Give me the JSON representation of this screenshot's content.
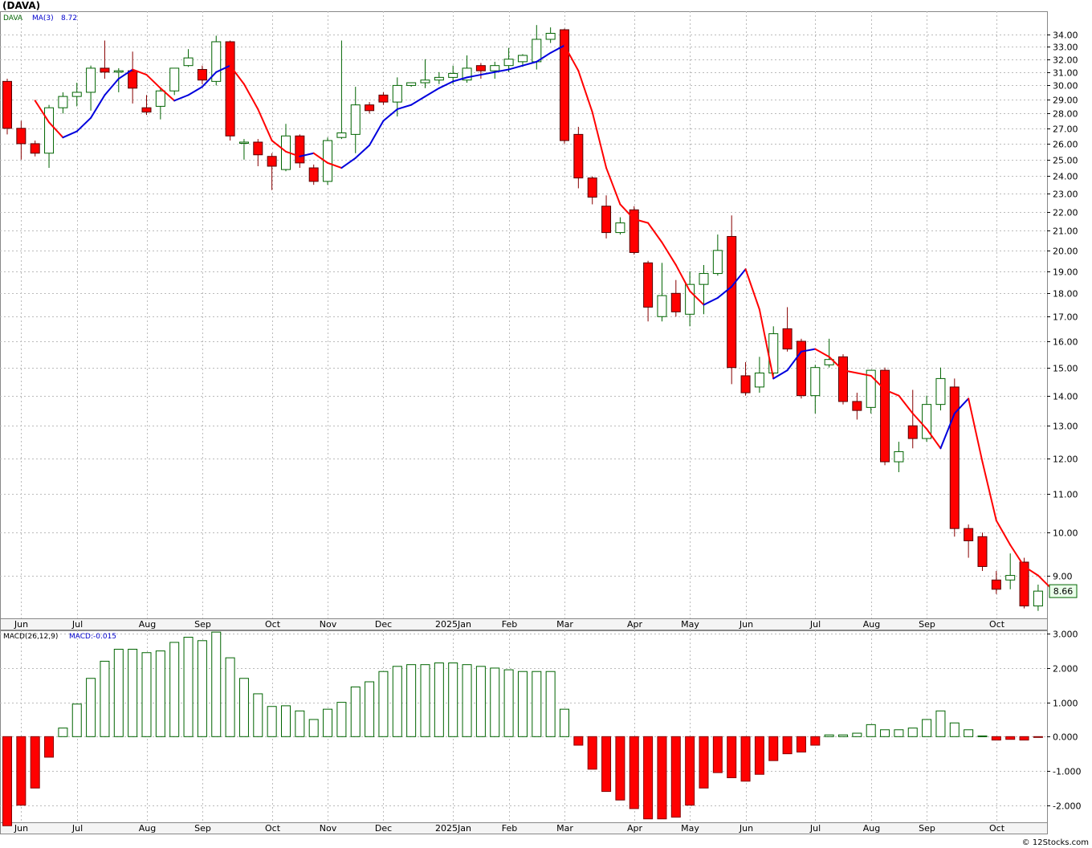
{
  "title": "(DAVA)",
  "watermark": "© 12Stocks.com",
  "legend": {
    "symbol": "DAVA",
    "ma_label": "MA(3)",
    "ma_value": "8.72",
    "macd_label": "MACD(26,12,9)",
    "macd_value": "MACD:-0.015"
  },
  "colors": {
    "up": "#006400",
    "down": "#ff0000",
    "ma_up": "#0000dd",
    "ma_down": "#ff0000",
    "bg": "#ffffff",
    "grid": "#bbbbbb"
  },
  "last_price_label": "8.66",
  "chart_data": [
    {
      "type": "candlestick",
      "scale": "log",
      "ylim": [
        8.1,
        36.0
      ],
      "yticks": [
        9,
        10,
        11,
        12,
        13,
        14,
        15,
        16,
        17,
        18,
        19,
        20,
        21,
        22,
        23,
        24,
        25,
        26,
        27,
        28,
        29,
        30,
        31,
        32,
        33,
        34
      ],
      "ytick_labels": [
        "9.00",
        "10.00",
        "11.00",
        "12.00",
        "13.00",
        "14.00",
        "15.00",
        "16.00",
        "17.00",
        "18.00",
        "19.00",
        "20.00",
        "21.00",
        "22.00",
        "23.00",
        "24.00",
        "25.00",
        "26.00",
        "27.00",
        "28.00",
        "29.00",
        "30.00",
        "31.00",
        "32.00",
        "33.00",
        "34.00"
      ],
      "month_labels": [
        "Jun",
        "Jul",
        "Aug",
        "Sep",
        "Oct",
        "Nov",
        "Dec",
        "2025Jan",
        "Feb",
        "Mar",
        "Apr",
        "May",
        "Jun",
        "Jul",
        "Aug",
        "Sep",
        "Oct"
      ],
      "month_label_week": [
        1,
        5,
        10,
        14,
        19,
        23,
        27,
        32,
        36,
        40,
        45,
        49,
        53,
        58,
        62,
        66,
        71
      ],
      "candles": [
        [
          30.3,
          30.5,
          26.6,
          27.0
        ],
        [
          27.0,
          27.5,
          25.0,
          26.0
        ],
        [
          26.0,
          26.2,
          25.2,
          25.4
        ],
        [
          25.4,
          28.6,
          24.5,
          28.4
        ],
        [
          28.4,
          29.5,
          28.0,
          29.2
        ],
        [
          29.2,
          30.2,
          28.5,
          29.5
        ],
        [
          29.5,
          31.5,
          28.2,
          31.3
        ],
        [
          31.3,
          33.5,
          30.5,
          31.0
        ],
        [
          31.0,
          31.3,
          29.5,
          31.1
        ],
        [
          31.1,
          32.6,
          28.7,
          29.8
        ],
        [
          28.4,
          29.3,
          27.9,
          28.1
        ],
        [
          28.5,
          29.8,
          27.6,
          29.6
        ],
        [
          29.6,
          31.3,
          29.3,
          31.3
        ],
        [
          31.5,
          32.8,
          31.4,
          32.1
        ],
        [
          31.2,
          31.5,
          30.1,
          30.4
        ],
        [
          30.3,
          33.9,
          30.0,
          33.4
        ],
        [
          33.4,
          33.5,
          26.2,
          26.5
        ],
        [
          26.1,
          26.3,
          25.0,
          26.1
        ],
        [
          26.1,
          26.3,
          24.6,
          25.3
        ],
        [
          25.2,
          25.4,
          23.2,
          24.6
        ],
        [
          24.4,
          27.3,
          24.3,
          26.5
        ],
        [
          26.5,
          26.6,
          24.5,
          24.8
        ],
        [
          24.5,
          24.7,
          23.5,
          23.7
        ],
        [
          23.7,
          26.4,
          23.5,
          26.2
        ],
        [
          26.4,
          33.5,
          26.3,
          26.7
        ],
        [
          26.6,
          29.9,
          25.4,
          28.6
        ],
        [
          28.6,
          28.8,
          28.0,
          28.2
        ],
        [
          29.3,
          29.5,
          28.6,
          28.8
        ],
        [
          28.8,
          30.6,
          27.8,
          30.0
        ],
        [
          30.0,
          30.1,
          29.9,
          30.2
        ],
        [
          30.2,
          32.0,
          29.8,
          30.4
        ],
        [
          30.4,
          31.0,
          30.1,
          30.6
        ],
        [
          30.6,
          31.5,
          30.1,
          30.9
        ],
        [
          30.4,
          32.3,
          30.2,
          31.3
        ],
        [
          31.5,
          31.7,
          30.5,
          31.1
        ],
        [
          31.1,
          31.8,
          30.5,
          31.5
        ],
        [
          31.5,
          32.9,
          31.0,
          32.0
        ],
        [
          31.8,
          32.4,
          31.4,
          32.3
        ],
        [
          31.8,
          34.8,
          31.2,
          33.6
        ],
        [
          33.6,
          34.6,
          33.3,
          34.1
        ],
        [
          34.4,
          34.5,
          26.0,
          26.2
        ],
        [
          26.6,
          27.1,
          23.3,
          23.9
        ],
        [
          23.9,
          24.0,
          22.4,
          22.8
        ],
        [
          22.3,
          22.9,
          20.6,
          20.9
        ],
        [
          20.9,
          21.7,
          20.8,
          21.4
        ],
        [
          22.1,
          22.3,
          19.8,
          19.9
        ],
        [
          19.4,
          19.5,
          16.8,
          17.4
        ],
        [
          17.0,
          19.4,
          16.8,
          17.9
        ],
        [
          18.0,
          18.6,
          17.0,
          17.2
        ],
        [
          17.1,
          19.0,
          16.6,
          18.4
        ],
        [
          18.4,
          19.3,
          17.1,
          18.9
        ],
        [
          18.9,
          20.8,
          18.8,
          20.0
        ],
        [
          20.7,
          21.8,
          14.4,
          15.0
        ],
        [
          14.7,
          15.2,
          14.0,
          14.1
        ],
        [
          14.3,
          15.4,
          14.1,
          14.8
        ],
        [
          14.8,
          16.6,
          14.7,
          16.3
        ],
        [
          16.5,
          17.4,
          15.6,
          15.7
        ],
        [
          16.0,
          16.1,
          13.9,
          14.0
        ],
        [
          14.0,
          15.1,
          13.4,
          15.0
        ],
        [
          15.1,
          16.1,
          15.0,
          15.3
        ],
        [
          15.4,
          15.5,
          13.7,
          13.8
        ],
        [
          13.8,
          14.1,
          13.2,
          13.5
        ],
        [
          13.6,
          14.9,
          13.4,
          14.9
        ],
        [
          14.9,
          15.0,
          11.8,
          11.9
        ],
        [
          11.9,
          12.5,
          11.6,
          12.2
        ],
        [
          13.0,
          14.2,
          12.3,
          12.6
        ],
        [
          12.6,
          14.0,
          12.5,
          13.7
        ],
        [
          13.7,
          15.0,
          13.5,
          14.6
        ],
        [
          14.3,
          14.6,
          9.9,
          10.1
        ],
        [
          10.1,
          10.2,
          9.4,
          9.8
        ],
        [
          9.9,
          10.0,
          9.1,
          9.2
        ],
        [
          8.9,
          9.1,
          8.6,
          8.7
        ],
        [
          8.9,
          9.5,
          8.7,
          9.0
        ],
        [
          9.3,
          9.4,
          8.3,
          8.35
        ],
        [
          8.35,
          8.8,
          8.25,
          8.66
        ]
      ],
      "ma3": [
        null,
        null,
        28.9,
        27.4,
        26.4,
        26.8,
        27.7,
        29.3,
        30.5,
        31.2,
        30.8,
        29.8,
        28.9,
        29.3,
        29.9,
        31.0,
        31.5,
        30.1,
        28.3,
        26.2,
        25.5,
        25.2,
        25.4,
        24.8,
        24.5,
        25.1,
        25.9,
        27.5,
        28.3,
        28.6,
        29.2,
        29.8,
        30.3,
        30.6,
        30.8,
        31.0,
        31.2,
        31.5,
        31.8,
        32.5,
        33.1,
        31.1,
        28.1,
        24.5,
        22.4,
        21.6,
        21.4,
        20.4,
        19.3,
        18.1,
        17.5,
        17.8,
        18.3,
        19.1,
        17.3,
        14.6,
        14.9,
        15.6,
        15.7,
        15.4,
        14.9,
        14.8,
        14.7,
        14.2,
        14.0,
        13.4,
        12.9,
        12.3,
        13.4,
        13.9,
        11.9,
        10.3,
        9.7,
        9.2,
        9.0,
        8.7
      ]
    },
    {
      "type": "bar",
      "name": "MACD(26,12,9)",
      "ylim": [
        -2.5,
        3.1
      ],
      "yticks": [
        -2,
        -1,
        0,
        1,
        2,
        3
      ],
      "ytick_labels": [
        "-2.000",
        "-1.000",
        "0.000",
        "1.000",
        "2.000",
        "3.000"
      ],
      "month_labels": [
        "Jun",
        "Jul",
        "Aug",
        "Sep",
        "Oct",
        "Nov",
        "Dec",
        "2025Jan",
        "Feb",
        "Mar",
        "Apr",
        "May",
        "Jun",
        "Jul",
        "Aug",
        "Sep",
        "Oct"
      ],
      "values": [
        -2.6,
        -2.0,
        -1.5,
        -0.6,
        0.25,
        0.95,
        1.7,
        2.2,
        2.55,
        2.55,
        2.45,
        2.5,
        2.75,
        2.9,
        2.8,
        3.05,
        2.3,
        1.7,
        1.25,
        0.88,
        0.9,
        0.75,
        0.5,
        0.8,
        1.0,
        1.45,
        1.6,
        1.9,
        2.05,
        2.1,
        2.1,
        2.15,
        2.15,
        2.1,
        2.05,
        2.0,
        1.95,
        1.9,
        1.9,
        1.9,
        0.8,
        -0.25,
        -0.95,
        -1.6,
        -1.85,
        -2.1,
        -2.4,
        -2.4,
        -2.35,
        -2.0,
        -1.5,
        -1.05,
        -1.2,
        -1.3,
        -1.1,
        -0.7,
        -0.5,
        -0.45,
        -0.25,
        0.05,
        0.05,
        0.1,
        0.35,
        0.2,
        0.2,
        0.25,
        0.5,
        0.75,
        0.4,
        0.2,
        0.02,
        -0.1,
        -0.08,
        -0.1,
        -0.015
      ]
    }
  ]
}
